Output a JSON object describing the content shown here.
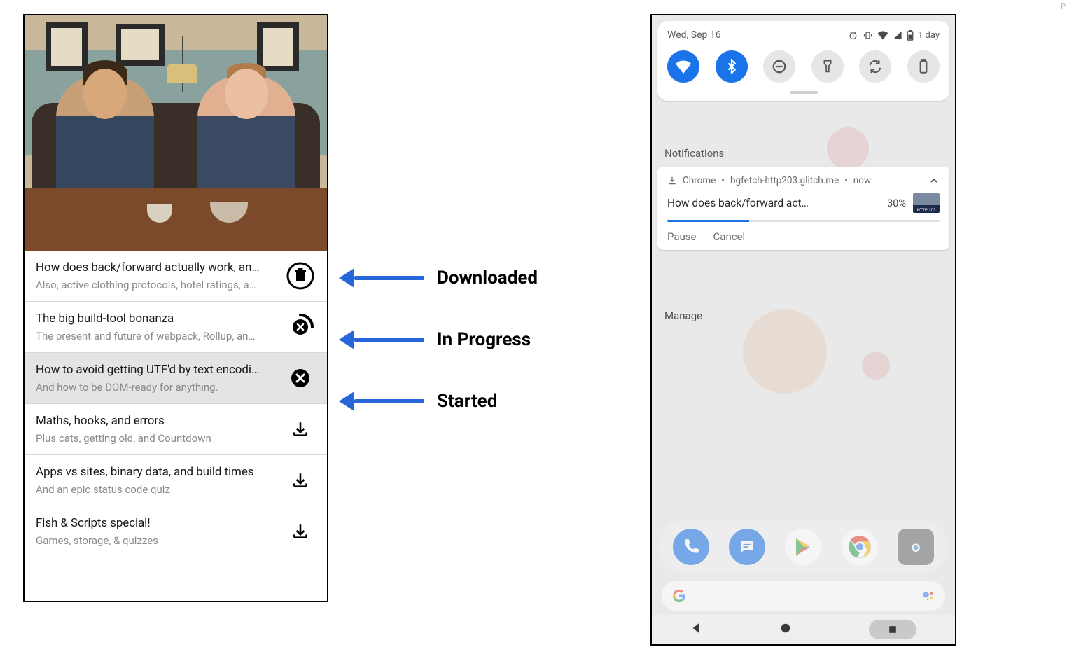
{
  "left": {
    "items": [
      {
        "state": "downloaded",
        "title": "How does back/forward actually work, an…",
        "subtitle": "Also, active clothing protocols, hotel ratings, a…"
      },
      {
        "state": "inprogress",
        "title": "The big build-tool bonanza",
        "subtitle": "The present and future of webpack, Rollup, an…"
      },
      {
        "state": "started",
        "title": "How to avoid getting UTF'd by text encodi…",
        "subtitle": "And how to be DOM-ready for anything.",
        "selected": true
      },
      {
        "state": "download",
        "title": "Maths, hooks, and errors",
        "subtitle": "Plus cats, getting old, and Countdown"
      },
      {
        "state": "download",
        "title": "Apps vs sites, binary data, and build times",
        "subtitle": "And an epic status code quiz"
      },
      {
        "state": "download",
        "title": "Fish & Scripts special!",
        "subtitle": "Games, storage, & quizzes"
      }
    ]
  },
  "arrow_labels": {
    "downloaded": "Downloaded",
    "inprogress": "In Progress",
    "started": "Started"
  },
  "right": {
    "status_date": "Wed, Sep 16",
    "status_battery_text": "1 day",
    "sections": {
      "notifications": "Notifications",
      "manage": "Manage"
    },
    "toggles": [
      {
        "name": "wifi",
        "on": true
      },
      {
        "name": "bluetooth",
        "on": true
      },
      {
        "name": "dnd",
        "on": false
      },
      {
        "name": "flashlight",
        "on": false
      },
      {
        "name": "autorotate",
        "on": false
      },
      {
        "name": "battery",
        "on": false
      }
    ],
    "notification": {
      "app": "Chrome",
      "source": "bgfetch-http203.glitch.me",
      "time_label": "now",
      "title": "How does back/forward act…",
      "percent_text": "30%",
      "progress_pct": 30,
      "thumb_caption": "HTTP 203",
      "actions": {
        "pause": "Pause",
        "cancel": "Cancel"
      }
    }
  },
  "colors": {
    "accent_blue": "#1a73e8",
    "arrow_blue": "#2766d8"
  }
}
